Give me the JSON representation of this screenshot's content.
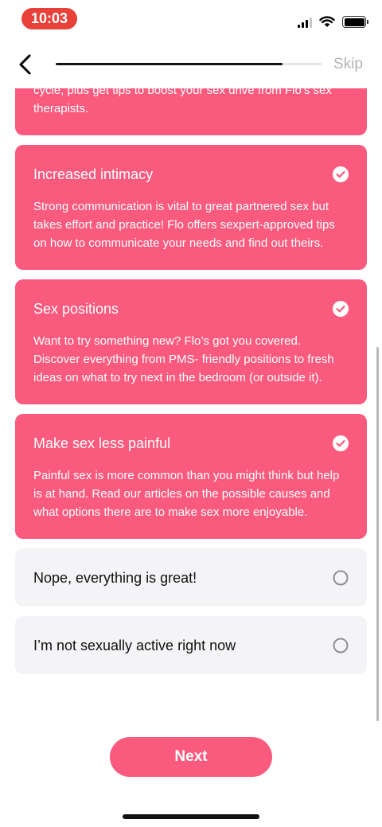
{
  "status_bar": {
    "time": "10:03"
  },
  "nav": {
    "skip_label": "Skip",
    "progress": 0.85
  },
  "options": [
    {
      "title": "",
      "body": "cycle, plus get tips to boost your sex drive from Flo’s sex therapists.",
      "selected": true
    },
    {
      "title": "Increased intimacy",
      "body": "Strong communication is vital to great partnered sex but takes effort and practice! Flo offers sexpert-approved tips on how to communicate your needs and find out theirs.",
      "selected": true
    },
    {
      "title": "Sex positions",
      "body": "Want to try something new? Flo’s got you covered. Discover everything from PMS- friendly positions to fresh ideas on what to try next in the bedroom (or outside it).",
      "selected": true
    },
    {
      "title": "Make sex less painful",
      "body": "Painful sex is more common than you might think but help is at hand. Read our articles on the possible causes and what options there are to make sex more enjoyable.",
      "selected": true
    },
    {
      "title": "Nope, everything is great!",
      "selected": false
    },
    {
      "title": "I’m not sexually active right now",
      "selected": false
    }
  ],
  "next_label": "Next",
  "colors": {
    "accent": "#fa5a7d",
    "unselected_bg": "#f4f4f6",
    "time_pill": "#e8413a"
  }
}
